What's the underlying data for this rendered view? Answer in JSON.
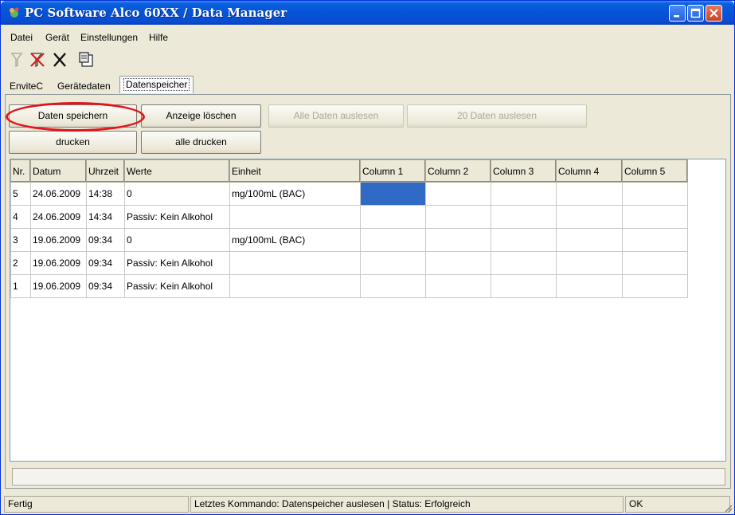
{
  "window": {
    "title": "PC Software Alco 60XX  / Data Manager",
    "controls": {
      "minimize": "_",
      "maximize": "□",
      "close": "✕"
    }
  },
  "menu": [
    "Datei",
    "Gerät",
    "Einstellungen",
    "Hilfe"
  ],
  "toolbar": {
    "icons": [
      "filter-icon",
      "delete-filter-icon",
      "delete-icon",
      "properties-icon"
    ]
  },
  "tabs": [
    "EnviteC",
    "Gerätedaten",
    "Datenspeicher"
  ],
  "active_tab": "Datenspeicher",
  "buttons": {
    "save": "Daten speichern",
    "clear": "Anzeige löschen",
    "read_all": "Alle Daten auslesen",
    "read_20": "20 Daten auslesen",
    "print": "drucken",
    "print_all": "alle drucken"
  },
  "table": {
    "columns": [
      "Nr.",
      "Datum",
      "Uhrzeit",
      "Werte",
      "Einheit",
      "Column 1",
      "Column 2",
      "Column 3",
      "Column 4",
      "Column 5"
    ],
    "rows": [
      [
        "5",
        "24.06.2009",
        "14:38",
        "0",
        "mg/100mL (BAC)",
        "",
        "",
        "",
        "",
        ""
      ],
      [
        "4",
        "24.06.2009",
        "14:34",
        "Passiv: Kein Alkohol",
        "",
        "",
        "",
        "",
        "",
        ""
      ],
      [
        "3",
        "19.06.2009",
        "09:34",
        "0",
        "mg/100mL (BAC)",
        "",
        "",
        "",
        "",
        ""
      ],
      [
        "2",
        "19.06.2009",
        "09:34",
        "Passiv: Kein Alkohol",
        "",
        "",
        "",
        "",
        "",
        ""
      ],
      [
        "1",
        "19.06.2009",
        "09:34",
        "Passiv: Kein Alkohol",
        "",
        "",
        "",
        "",
        "",
        ""
      ]
    ]
  },
  "status": {
    "left": "Fertig",
    "middle": "Letztes Kommando: Datenspeicher auslesen | Status: Erfolgreich",
    "right": "OK"
  },
  "colors": {
    "titlebar": "#0554d8",
    "highlight": "#e4141a",
    "selection": "#316ac5"
  }
}
